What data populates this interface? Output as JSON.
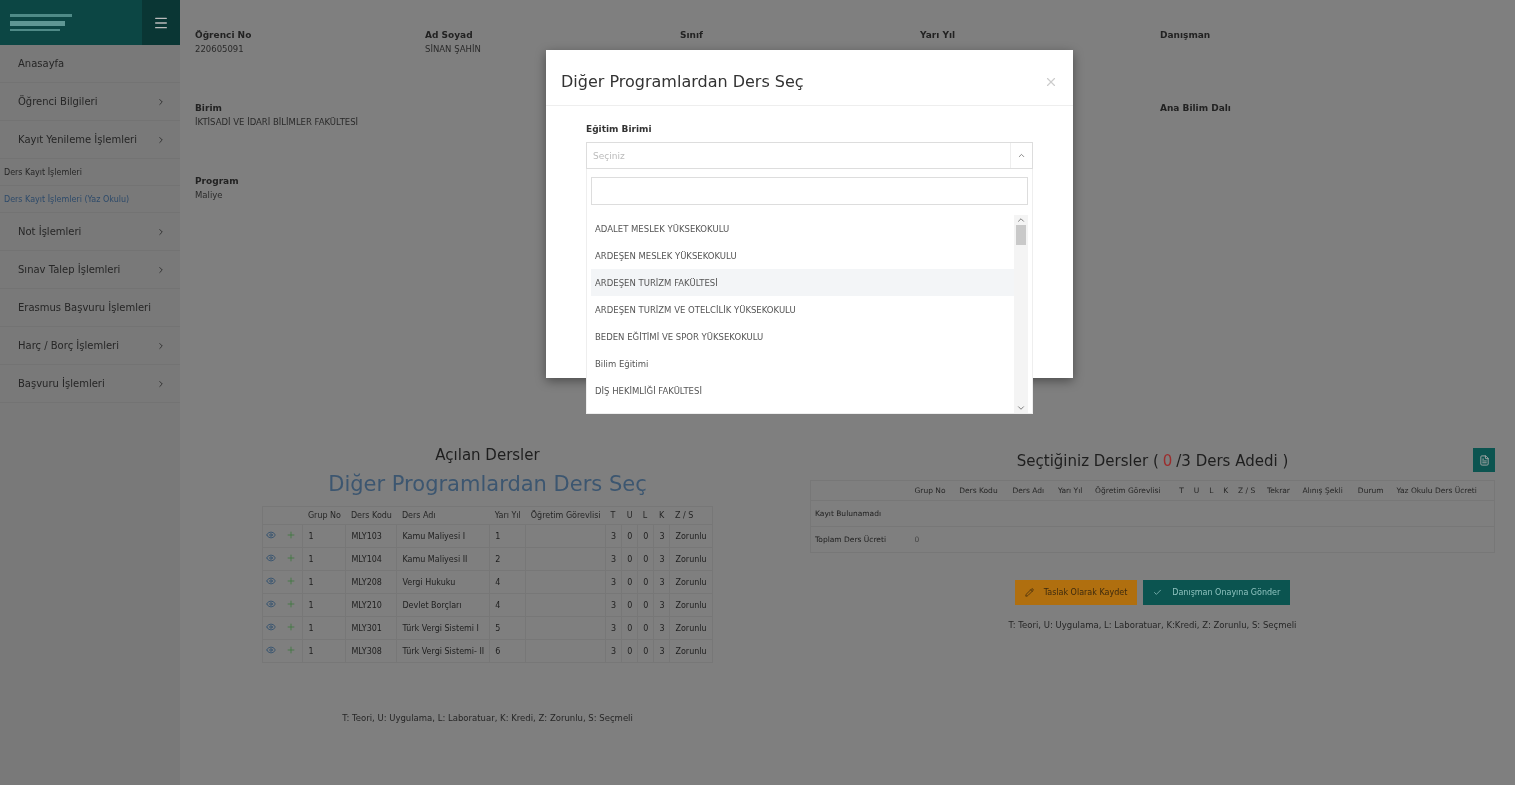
{
  "sidebar": {
    "menu": [
      {
        "label": "Anasayfa",
        "kind": "item",
        "has_submenu": false,
        "selected": false
      },
      {
        "label": "Öğrenci Bilgileri",
        "kind": "item",
        "has_submenu": true,
        "selected": false
      },
      {
        "label": "Kayıt Yenileme İşlemleri",
        "kind": "item",
        "has_submenu": true,
        "selected": false
      },
      {
        "label": "Ders Kayıt İşlemleri",
        "kind": "subitem",
        "has_submenu": false,
        "selected": false
      },
      {
        "label": "Ders Kayıt İşlemleri (Yaz Okulu)",
        "kind": "subitem",
        "has_submenu": false,
        "selected": true
      },
      {
        "label": "Not İşlemleri",
        "kind": "item",
        "has_submenu": true,
        "selected": false
      },
      {
        "label": "Sınav Talep İşlemleri",
        "kind": "item",
        "has_submenu": true,
        "selected": false
      },
      {
        "label": "Erasmus Başvuru İşlemleri",
        "kind": "item",
        "has_submenu": false,
        "selected": false
      },
      {
        "label": "Harç / Borç İşlemleri",
        "kind": "item",
        "has_submenu": true,
        "selected": false
      },
      {
        "label": "Başvuru İşlemleri",
        "kind": "item",
        "has_submenu": true,
        "selected": false
      }
    ]
  },
  "info_rows": [
    [
      {
        "label": "Öğrenci No",
        "value": "220605091"
      },
      {
        "label": "Ad Soyad",
        "value": "SİNAN ŞAHİN"
      },
      {
        "label": "Sınıf"
      },
      {
        "label": "Yarı Yıl"
      },
      {
        "label": "Danışman"
      }
    ],
    [
      {
        "label": "Birim",
        "value": "İKTİSADİ VE İDARİ BİLİMLER FAKÜLTESİ"
      },
      {},
      {},
      {},
      {
        "label": "Ana Bilim Dalı"
      }
    ],
    [
      {
        "label": "Program",
        "value": "Maliye"
      }
    ]
  ],
  "offered": {
    "title": "Açılan Dersler",
    "link": "Diğer Programlardan Ders Seç",
    "columns": [
      "Grup No",
      "Ders Kodu",
      "Ders Adı",
      "Yarı Yıl",
      "Öğretim Görevlisi",
      "T",
      "U",
      "L",
      "K",
      "Z / S"
    ],
    "rows": [
      {
        "cells": [
          "1",
          "MLY103",
          "Kamu Maliyesi I",
          "1",
          "",
          "3",
          "0",
          "0",
          "3",
          "Zorunlu"
        ]
      },
      {
        "cells": [
          "1",
          "MLY104",
          "Kamu Maliyesi II",
          "2",
          "",
          "3",
          "0",
          "0",
          "3",
          "Zorunlu"
        ]
      },
      {
        "cells": [
          "1",
          "MLY208",
          "Vergi Hukuku",
          "4",
          "",
          "3",
          "0",
          "0",
          "3",
          "Zorunlu"
        ]
      },
      {
        "cells": [
          "1",
          "MLY210",
          "Devlet Borçları",
          "4",
          "",
          "3",
          "0",
          "0",
          "3",
          "Zorunlu"
        ]
      },
      {
        "cells": [
          "1",
          "MLY301",
          "Türk Vergi Sistemi I",
          "5",
          "",
          "3",
          "0",
          "0",
          "3",
          "Zorunlu"
        ]
      },
      {
        "cells": [
          "1",
          "MLY308",
          "Türk Vergi Sistemi- II",
          "6",
          "",
          "3",
          "0",
          "0",
          "3",
          "Zorunlu"
        ]
      }
    ],
    "legend": "T: Teori, U: Uygulama, L: Laboratuar, K: Kredi, Z: Zorunlu, S: Seçmeli"
  },
  "selected_courses": {
    "title_prefix": "Seçtiğiniz Dersler (",
    "count": "0",
    "title_suffix": "/3 Ders Adedi )",
    "columns": [
      "Grup No",
      "Ders Kodu",
      "Ders Adı",
      "Yarı Yıl",
      "Öğretim Görevlisi",
      "T",
      "U",
      "L",
      "K",
      "Z / S",
      "Tekrar",
      "Alınış Şekli",
      "Durum",
      "Yaz Okulu Ders Ücreti"
    ],
    "empty_text": "Kayıt Bulunamadı",
    "total_label": "Toplam Ders Ücreti",
    "total_value": "0",
    "buttons": [
      {
        "label": "Taslak Olarak Kaydet",
        "kind": "draft"
      },
      {
        "label": "Danışman Onayına Gönder",
        "kind": "submit"
      }
    ],
    "legend": "T: Teori, U: Uygulama, L: Laboratuar, K:Kredi, Z: Zorunlu, S: Seçmeli"
  },
  "modal": {
    "title": "Diğer Programlardan Ders Seç",
    "field_label": "Eğitim Birimi",
    "placeholder": "Seçiniz",
    "options": [
      {
        "label": "ADALET MESLEK YÜKSEKOKULU",
        "selected": false
      },
      {
        "label": "ARDEŞEN MESLEK YÜKSEKOKULU",
        "selected": false
      },
      {
        "label": "ARDEŞEN TURİZM FAKÜLTESİ",
        "selected": true
      },
      {
        "label": "ARDEŞEN TURİZM VE OTELCİLİK YÜKSEKOKULU",
        "selected": false
      },
      {
        "label": "BEDEN EĞİTİMİ VE SPOR YÜKSEKOKULU",
        "selected": false
      },
      {
        "label": "Bilim Eğitimi",
        "selected": false
      },
      {
        "label": "DİŞ HEKİMLİĞİ FAKÜLTESİ",
        "selected": false
      }
    ]
  }
}
